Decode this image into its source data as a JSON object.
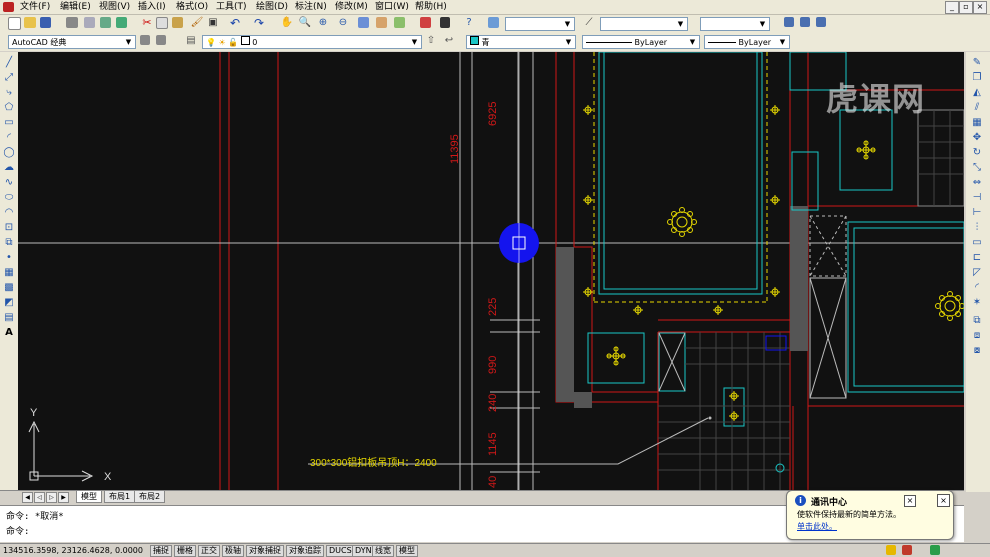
{
  "menu": [
    "文件(F)",
    "编辑(E)",
    "视图(V)",
    "插入(I)",
    "格式(O)",
    "工具(T)",
    "绘图(D)",
    "标注(N)",
    "修改(M)",
    "窗口(W)",
    "帮助(H)"
  ],
  "workspace": "AutoCAD 经典",
  "layer": "0",
  "color": "青",
  "linetype1": "ByLayer",
  "linetype2": "ByLayer",
  "watermark": "虎课网",
  "drawing": {
    "dims_vertical": [
      "11395",
      "6925",
      "225",
      "990",
      "240",
      "1145",
      "40"
    ],
    "annotation": "300*300铝扣板吊顶H：2400",
    "ucs_y": "Y",
    "ucs_x": "X"
  },
  "tabs": [
    "模型",
    "布局1",
    "布局2"
  ],
  "command": {
    "line1": "命令: *取消*",
    "line2": "命令:"
  },
  "status": {
    "coords": "134516.3598, 23126.4628, 0.0000",
    "buttons": [
      "捕捉",
      "栅格",
      "正交",
      "极轴",
      "对象捕捉",
      "对象追踪",
      "DUCS",
      "DYN",
      "线宽",
      "模型"
    ]
  },
  "notification": {
    "title": "通讯中心",
    "message": "使软件保持最新的简单方法。",
    "link": "单击此处。"
  },
  "colors": {
    "canvas": "#111111",
    "red_lines": "#d01818",
    "cyan_lines": "#19c6c6",
    "yellow_fixtures": "#e6d800",
    "cursor_blue": "#1414ee"
  }
}
